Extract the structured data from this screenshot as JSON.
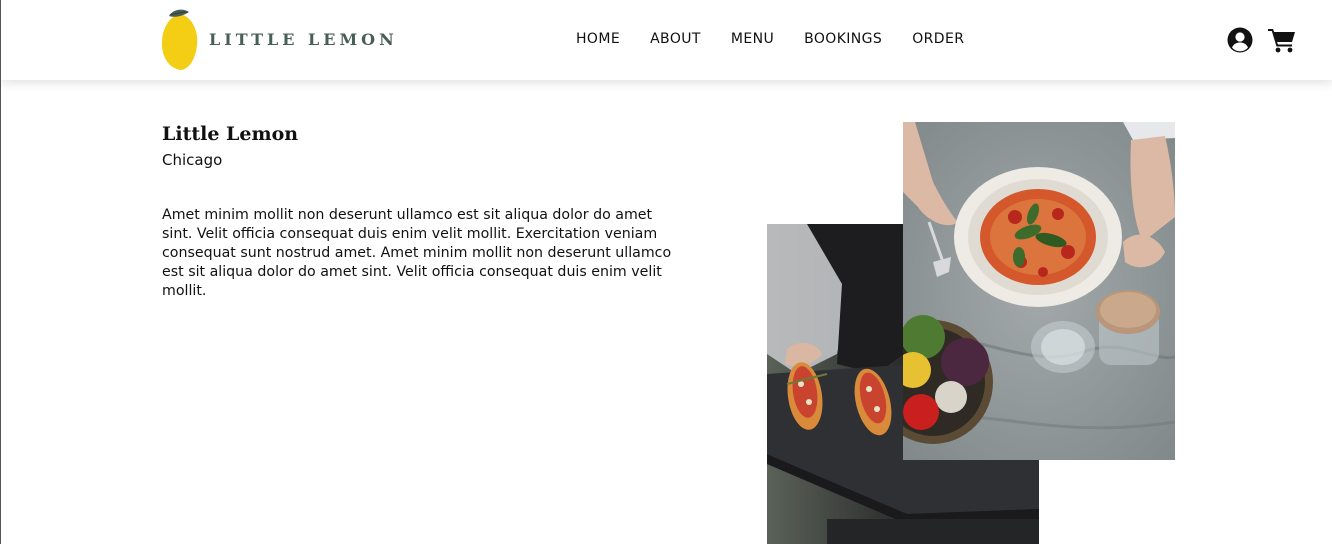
{
  "brand": {
    "name": "LITTLE LEMON",
    "logo_color": "#f4ce14",
    "leaf_color": "#495e57",
    "text_color": "#495e57"
  },
  "nav": {
    "items": [
      {
        "label": "HOME"
      },
      {
        "label": "ABOUT"
      },
      {
        "label": "MENU"
      },
      {
        "label": "BOOKINGS"
      },
      {
        "label": "ORDER"
      }
    ]
  },
  "header_icons": {
    "account": "user-circle-icon",
    "cart": "shopping-cart-icon"
  },
  "about": {
    "title": "Little Lemon",
    "subtitle": "Chicago",
    "description": "Amet minim mollit non deserunt ullamco est sit aliqua dolor do amet sint. Velit officia consequat duis enim velit mollit. Exercitation veniam consequat sunt nostrud amet. Amet minim mollit non deserunt ullamco est sit aliqua dolor do amet sint. Velit officia consequat duis enim velit mollit."
  },
  "images": {
    "back": "chef-holding-bruschetta-platter",
    "front": "spaghetti-plate-with-vegetables"
  }
}
